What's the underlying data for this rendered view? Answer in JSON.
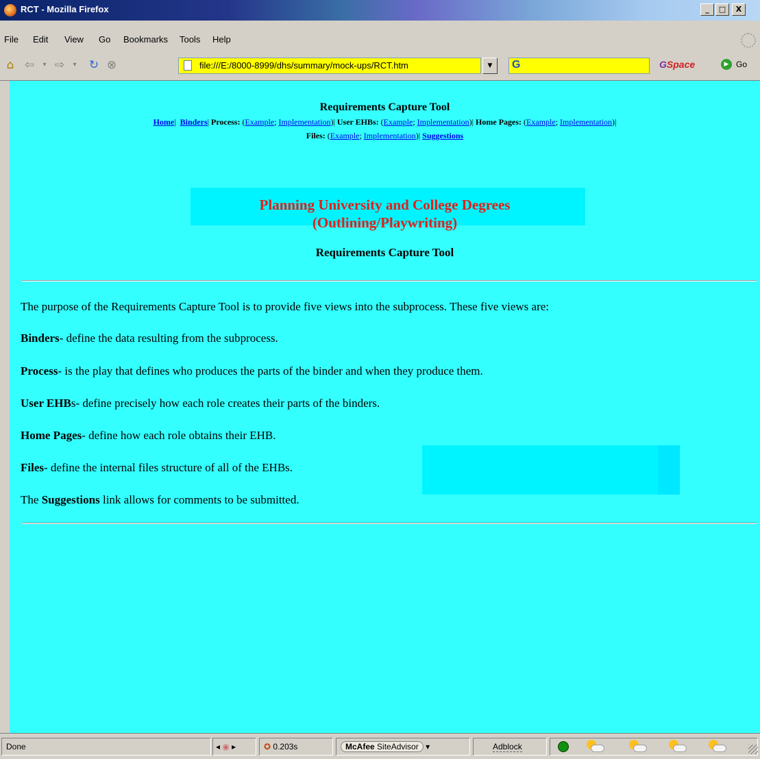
{
  "window": {
    "title": "RCT - Mozilla Firefox",
    "min": "_",
    "max": "□",
    "close": "X"
  },
  "menu": [
    "File",
    "Edit",
    "View",
    "Go",
    "Bookmarks",
    "Tools",
    "Help"
  ],
  "toolbar": {
    "url": "file:///E:/8000-8999/dhs/summary/mock-ups/RCT.htm",
    "search_value": "",
    "gspace_g": "G",
    "gspace_rest": "Space",
    "go_label": "Go"
  },
  "page": {
    "header_title": "Requirements Capture Tool",
    "nav": {
      "home": "Home",
      "sep_bar": "|",
      "binders": "Binders",
      "process_label": "Process:",
      "user_ehbs_label": "User EHBs:",
      "home_pages_label": "Home Pages:",
      "files_label": "Files:",
      "example": "Example",
      "implementation": "Implementation",
      "suggestions": "Suggestions"
    },
    "degree_title": "Planning University and College Degrees",
    "degree_subtitle": "(Outlining/Playwriting)",
    "subtitle": "Requirements Capture Tool",
    "intro": "The purpose of the Requirements Capture Tool is to provide five views into the subprocess. These five views are:",
    "items": [
      {
        "term": "Binders",
        "desc": "- define the data resulting from the subprocess."
      },
      {
        "term": "Process",
        "desc": "- is the play that defines who produces the parts of the binder and when they produce them."
      },
      {
        "term": "User EHB",
        "suffix": "s",
        "desc": "- define precisely how each role creates their parts of the binders."
      },
      {
        "term": "Home Pages",
        "desc": "- define how each role obtains their EHB."
      },
      {
        "term": "Files",
        "desc": "- define the internal files structure of all of the EHBs."
      }
    ],
    "suggest_pre": "The ",
    "suggest_term": "Suggestions",
    "suggest_post": " link allows for comments to be submitted."
  },
  "status": {
    "text": "Done",
    "timer": "0.203s",
    "mcafee_brand": "McAfee",
    "mcafee_rest": "SiteAdvisor",
    "adblock": "Adblock"
  },
  "colors": {
    "page_bg": "#33ffff",
    "banner_bg": "#00f4ff",
    "degree_title": "#e0201a",
    "link": "#0000ee",
    "url_bg": "#ffff00"
  }
}
